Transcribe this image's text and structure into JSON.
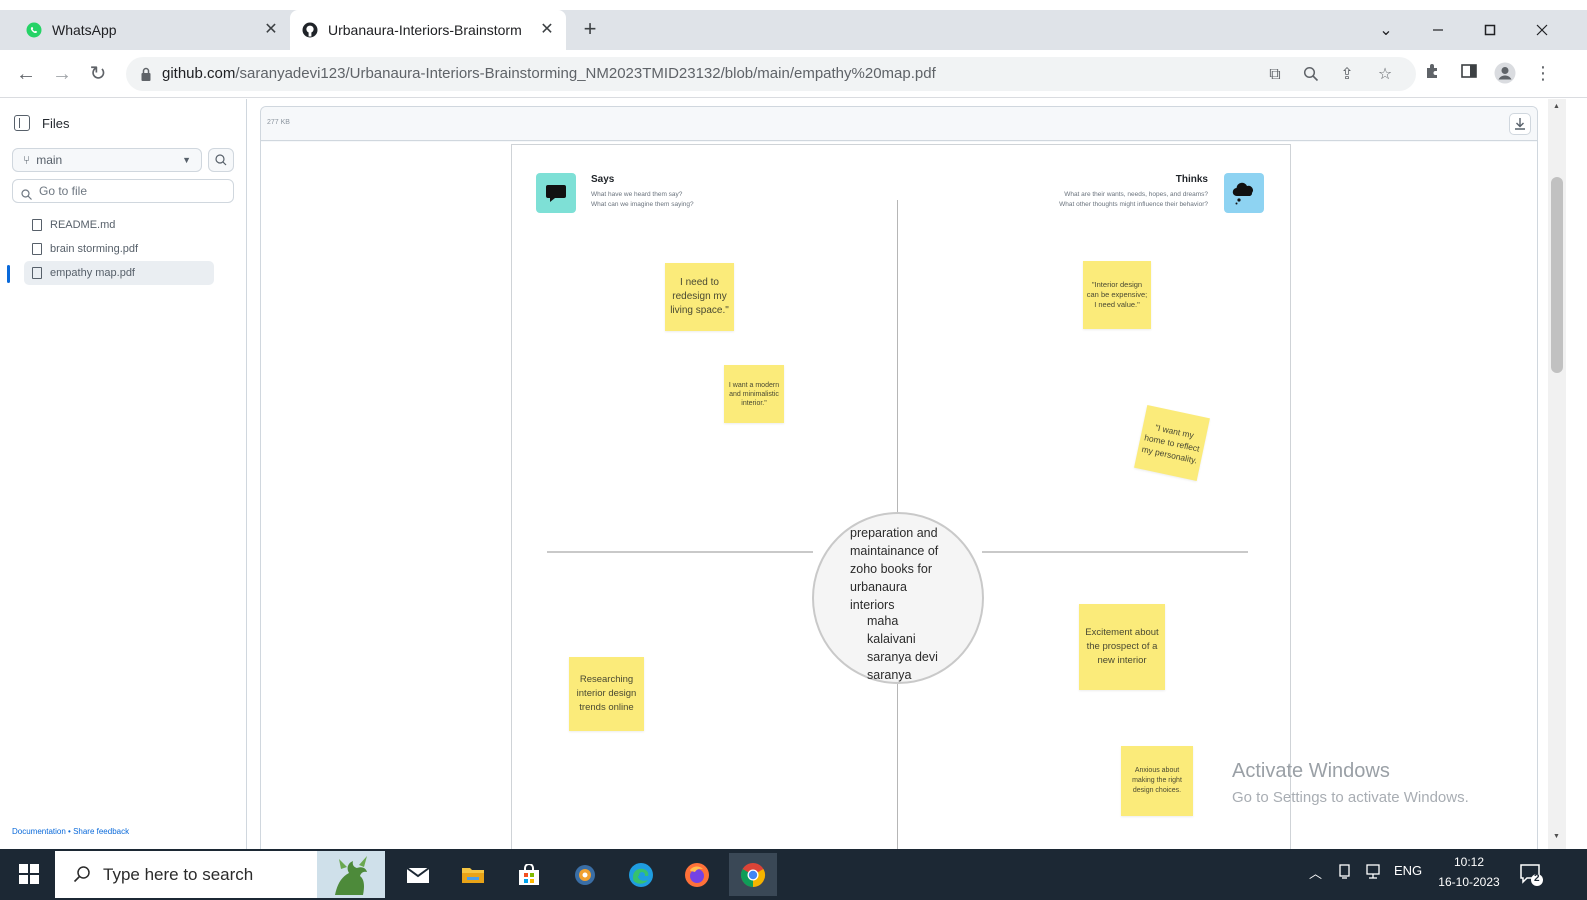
{
  "browser": {
    "tabs": [
      {
        "label": "WhatsApp",
        "active": false
      },
      {
        "label": "Urbanaura-Interiors-Brainstorm",
        "active": true
      }
    ],
    "new_tab_label": "+",
    "url_host": "github.com",
    "url_path": "/saranyadevi123/Urbanaura-Interiors-Brainstorming_NM2023TMID23132/blob/main/empathy%20map.pdf"
  },
  "sidebar": {
    "title": "Files",
    "branch": "main",
    "goto_placeholder": "Go to file",
    "files": [
      {
        "name": "README.md",
        "active": false
      },
      {
        "name": "brain storming.pdf",
        "active": false
      },
      {
        "name": "empathy map.pdf",
        "active": true
      }
    ],
    "footer_doc": "Documentation",
    "footer_sep": " • ",
    "footer_feedback": "Share feedback"
  },
  "viewer": {
    "file_size": "277 KB"
  },
  "empathy_map": {
    "says": {
      "title": "Says",
      "line1": "What have we heard them say?",
      "line2": "What can we imagine them saying?",
      "icon_color": "#7ee0d6"
    },
    "thinks": {
      "title": "Thinks",
      "line1": "What are their wants, needs, hopes, and dreams?",
      "line2": "What other thoughts might influence their behavior?",
      "icon_color": "#8ed3f2"
    },
    "center": {
      "line1": "preparation and\nmaintainance of\nzoho books for\nurbanaura\ninteriors",
      "line2": "maha\nkalaivani\nsaranya devi\nsaranya"
    },
    "stickies": [
      "I need to redesign my living space.\"",
      "I want a modern and minimalistic interior.\"",
      "\"Interior design can be expensive; I need value.\"",
      "\"I want my home to reflect my personality.",
      "Excitement about the prospect of a new interior",
      "Researching interior design trends online",
      "Anxious about making the right design choices."
    ],
    "sticky_color": "#fbeb7a"
  },
  "watermark": {
    "title": "Activate Windows",
    "subtitle": "Go to Settings to activate Windows."
  },
  "taskbar": {
    "search_placeholder": "Type here to search",
    "language": "ENG",
    "time": "10:12",
    "date": "16-10-2023",
    "notification_count": "2"
  }
}
